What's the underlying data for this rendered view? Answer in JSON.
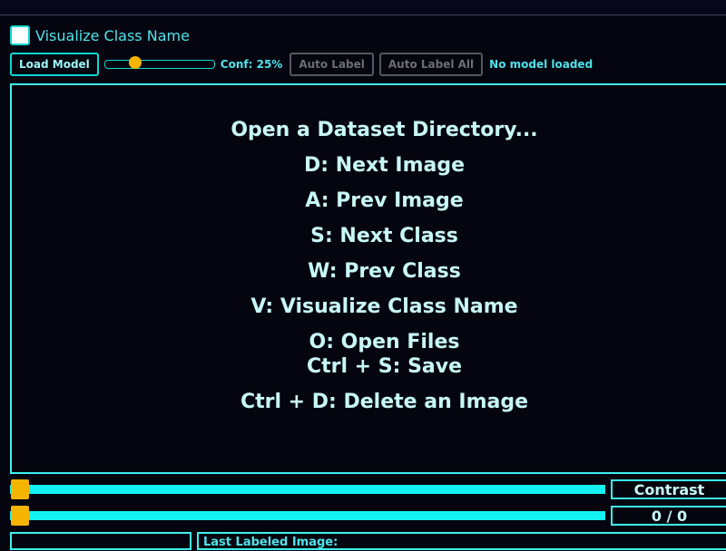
{
  "options": {
    "visualize_checkbox_label": "Visualize Class Name",
    "visualize_checked": false
  },
  "toolbar": {
    "load_model_label": "Load Model",
    "confidence_value": 0.25,
    "confidence_label": "Conf: 25%",
    "auto_label_label": "Auto Label",
    "auto_label_all_label": "Auto Label All",
    "model_status": "No model loaded"
  },
  "canvas": {
    "help_lines": [
      "Open a Dataset Directory...",
      "D: Next Image",
      "A: Prev Image",
      "S: Next Class",
      "W: Prev Class",
      "V: Visualize Class Name",
      "O: Open Files",
      "Ctrl + S: Save",
      "Ctrl + D: Delete an Image"
    ]
  },
  "adjustments": {
    "contrast_label": "Contrast",
    "contrast_value": 0,
    "image_counter": "0 / 0",
    "image_position_value": 0
  },
  "footer": {
    "last_labeled_label": "Last Labeled Image:"
  },
  "colors": {
    "accent": "#11d6d6",
    "knob": "#f4b400",
    "background": "#05050f",
    "disabled": "#55585e"
  }
}
